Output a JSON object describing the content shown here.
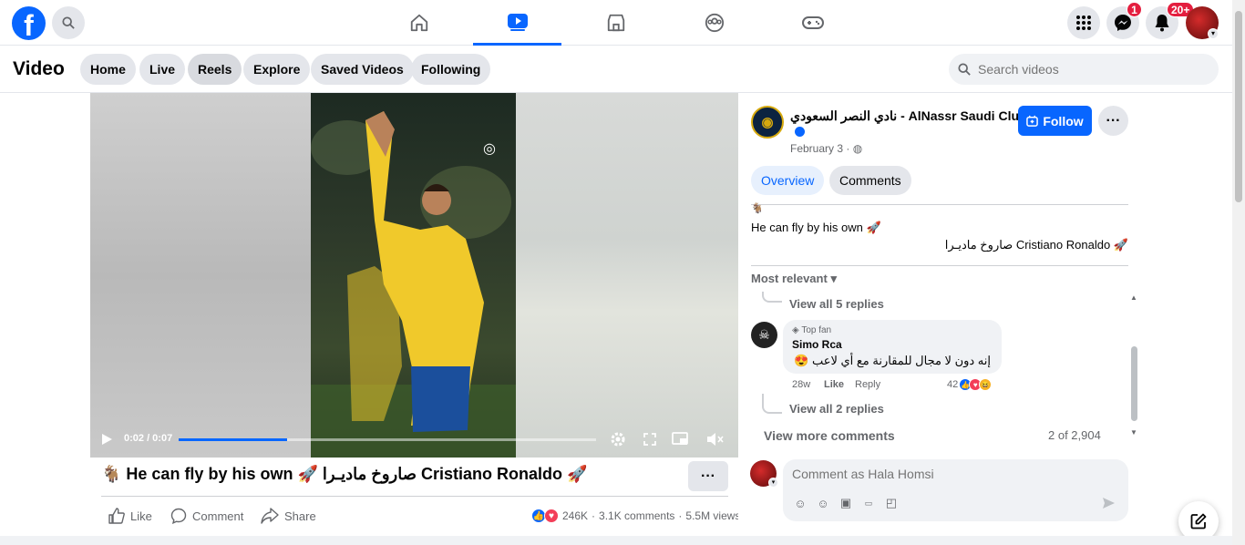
{
  "colors": {
    "brand": "#0866ff",
    "badge": "#e41e3f"
  },
  "topbar": {
    "logo_letter": "f",
    "nav": [
      "home-icon",
      "video-icon",
      "marketplace-icon",
      "groups-icon",
      "gaming-icon"
    ],
    "messenger_badge": "1",
    "notifications_badge": "20+"
  },
  "subnav": {
    "title": "Video",
    "pills": [
      "Home",
      "Live",
      "Reels",
      "Explore",
      "Saved Videos",
      "Following"
    ],
    "search_placeholder": "Search videos"
  },
  "player": {
    "time": "0:02 / 0:07",
    "progress_fraction": 0.26
  },
  "post": {
    "title": "🐐 He can fly by his own 🚀 صاروخ ماديـرا Cristiano Ronaldo 🚀",
    "actions": {
      "like": "Like",
      "comment": "Comment",
      "share": "Share"
    },
    "reactions_count": "246K",
    "comments_count": "3.1K comments",
    "views": "5.5M views"
  },
  "side": {
    "page_name": "نادي النصر السعودي - AlNassr Saudi Club",
    "date": "February 3 ·",
    "follow_label": "Follow",
    "tabs": {
      "overview": "Overview",
      "comments": "Comments"
    },
    "desc_line0": "🐐",
    "desc_line1": "He can fly by his own 🚀",
    "desc_line2": "🚀 Cristiano Ronaldo صاروخ ماديـرا",
    "sort_label": "Most relevant",
    "view_replies_1": "View all 5 replies",
    "comment": {
      "badge": "Top fan",
      "author": "Simo Rca",
      "text": "إنه دون لا مجال للمقارنة مع أي لاعب 😍",
      "age": "28w",
      "like": "Like",
      "reply": "Reply",
      "reactions": "42"
    },
    "view_replies_2": "View all 2 replies",
    "view_more": "View more comments",
    "count": "2 of 2,904",
    "comment_placeholder": "Comment as Hala Homsi"
  }
}
